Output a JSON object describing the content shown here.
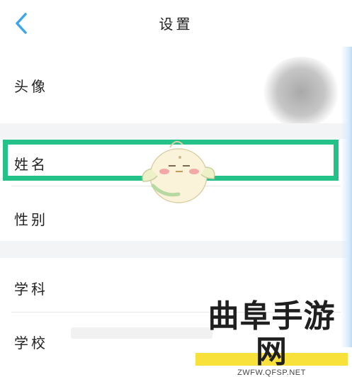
{
  "header": {
    "title": "设置",
    "back_icon": "chevron-left-icon",
    "accent": "#3aa8e8"
  },
  "rows": {
    "avatar": "头像",
    "name": "姓名",
    "gender": "性别",
    "subject": "学科",
    "school": "学校"
  },
  "highlight_color": "#24c289",
  "watermark": {
    "title": "曲阜手游网",
    "url": "ZWFW.QFSP.NET"
  }
}
